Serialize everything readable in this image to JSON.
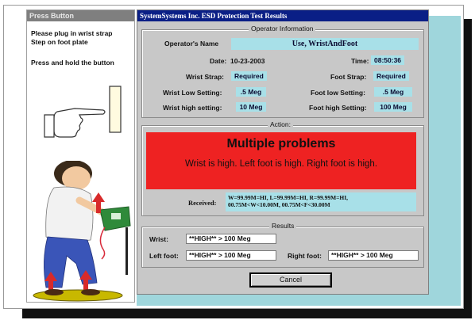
{
  "left_window": {
    "title": "Press Button",
    "instructions": [
      "Please plug in wrist strap",
      "Step on foot plate",
      "Press and hold the button"
    ]
  },
  "main_window": {
    "title": "SystemSystems Inc. ESD Protection Test Results"
  },
  "operator_info": {
    "legend": "Operator Information",
    "operator_name_label": "Operator's Name",
    "operator_name": "Use, WristAndFoot",
    "date_label": "Date:",
    "date": "10-23-2003",
    "time_label": "Time:",
    "time": "08:50:36",
    "wrist_strap_label": "Wrist Strap:",
    "wrist_strap": "Required",
    "foot_strap_label": "Foot Strap:",
    "foot_strap": "Required",
    "wrist_low_label": "Wrist Low Setting:",
    "wrist_low": ".5 Meg",
    "foot_low_label": "Foot low Setting:",
    "foot_low": ".5 Meg",
    "wrist_high_label": "Wrist high setting:",
    "wrist_high": "10 Meg",
    "foot_high_label": "Foot high Setting:",
    "foot_high": "100 Meg"
  },
  "action": {
    "legend": "Action:",
    "headline": "Multiple problems",
    "message": "Wrist is high. Left foot is high. Right foot is high.",
    "received_label": "Received:",
    "received_line1": "W=99.99M=HI, L=99.99M=HI, R=99.99M=HI,",
    "received_line2": "00.75M<W<10.00M, 00.75M<F<30.00M"
  },
  "results": {
    "legend": "Results",
    "wrist_label": "Wrist:",
    "wrist_value": "**HIGH** > 100 Meg",
    "left_foot_label": "Left foot:",
    "left_foot_value": "**HIGH** > 100 Meg",
    "right_foot_label": "Right foot:",
    "right_foot_value": "**HIGH** > 100 Meg"
  },
  "cancel_button": {
    "label": "Cancel"
  },
  "colors": {
    "title_bar": "#0a1f86",
    "action_red": "#ee2222",
    "field_cyan": "#a8e0e8",
    "window_gray": "#c8c8c8"
  }
}
